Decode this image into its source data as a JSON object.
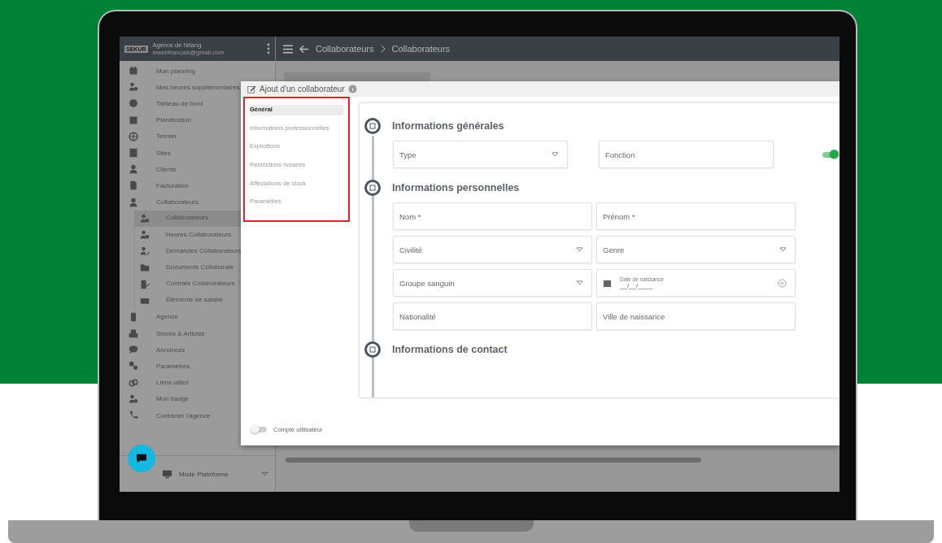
{
  "app": {
    "logo": "SEKUR",
    "agency": "Agence de l'étang",
    "email": "lewebfrancais@gmail.com"
  },
  "breadcrumb": [
    "Collaborateurs",
    "Collaborateurs"
  ],
  "sidebar": {
    "items": [
      {
        "label": "Mon planning",
        "selected": false
      },
      {
        "label": "Mes heures supplémentaires",
        "selected": false
      },
      {
        "label": "Tableau de bord",
        "selected": false
      },
      {
        "label": "Planification",
        "selected": false
      },
      {
        "label": "Terrain",
        "selected": false
      },
      {
        "label": "Sites",
        "selected": false
      },
      {
        "label": "Clients",
        "selected": false
      },
      {
        "label": "Facturation",
        "selected": false
      },
      {
        "label": "Collaborateurs",
        "selected": false,
        "expanded": true,
        "children": [
          {
            "label": "Collaborateurs",
            "selected": true
          },
          {
            "label": "Heures Collaborateurs",
            "selected": false
          },
          {
            "label": "Demandes Collaborateurs",
            "selected": false
          },
          {
            "label": "Documents Collaborate",
            "selected": false
          },
          {
            "label": "Contrats Collaborateurs",
            "selected": false
          },
          {
            "label": "Éléments de salaire",
            "selected": false
          }
        ]
      },
      {
        "label": "Agence",
        "selected": false
      },
      {
        "label": "Stocks & Articles",
        "selected": false
      },
      {
        "label": "Annonces",
        "selected": false
      },
      {
        "label": "Paramètres",
        "selected": false
      },
      {
        "label": "Liens utiles",
        "selected": false
      },
      {
        "label": "Mon badge",
        "selected": false
      },
      {
        "label": "Contacter l'agence",
        "selected": false
      }
    ],
    "mode": "Mode Plateforme"
  },
  "modal": {
    "title": "Ajout d'un collaborateur",
    "nav": [
      {
        "label": "Général",
        "selected": true
      },
      {
        "label": "Informations professionnelles",
        "selected": false
      },
      {
        "label": "Expirations",
        "selected": false
      },
      {
        "label": "Restrictions horaires",
        "selected": false
      },
      {
        "label": "Affectations de stock",
        "selected": false
      },
      {
        "label": "Paramètres",
        "selected": false
      }
    ],
    "sections": [
      {
        "title": "Informations générales",
        "toggle_on": true,
        "fields": [
          {
            "kind": "select",
            "placeholder": "Type"
          },
          {
            "kind": "text",
            "placeholder": "Fonction"
          }
        ]
      },
      {
        "title": "Informations personnelles",
        "fields": [
          {
            "kind": "text",
            "placeholder": "Nom *"
          },
          {
            "kind": "text",
            "placeholder": "Prénom *"
          },
          {
            "kind": "select",
            "placeholder": "Civilité"
          },
          {
            "kind": "select",
            "placeholder": "Genre"
          },
          {
            "kind": "select",
            "placeholder": "Groupe sanguin"
          },
          {
            "kind": "date",
            "label": "Date de naissance",
            "value": "__/__/____"
          },
          {
            "kind": "text",
            "placeholder": "Nationalité"
          },
          {
            "kind": "text",
            "placeholder": "Ville de naissance"
          }
        ]
      },
      {
        "title": "Informations de contact"
      }
    ],
    "user_account": {
      "label": "Compte utilisateur",
      "on": false
    }
  }
}
